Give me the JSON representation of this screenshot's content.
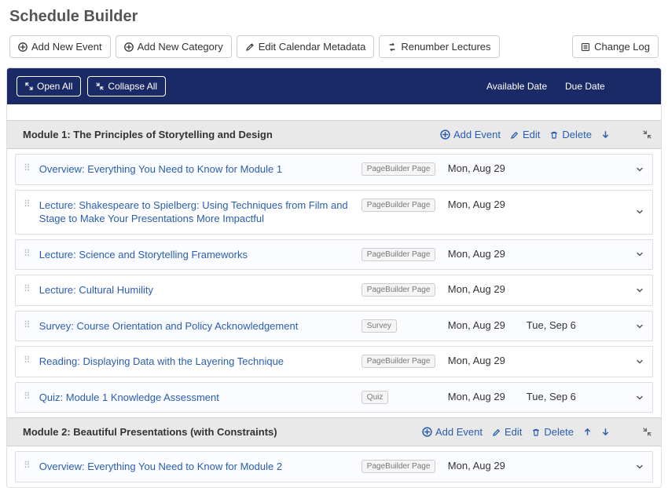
{
  "page": {
    "title": "Schedule Builder"
  },
  "toolbar": {
    "add_event": "Add New Event",
    "add_category": "Add New Category",
    "edit_metadata": "Edit Calendar Metadata",
    "renumber": "Renumber Lectures",
    "change_log": "Change Log"
  },
  "bluebar": {
    "open_all": "Open All",
    "collapse_all": "Collapse All",
    "available_header": "Available Date",
    "due_header": "Due Date"
  },
  "module_actions": {
    "add_event": "Add Event",
    "edit": "Edit",
    "delete": "Delete"
  },
  "modules": [
    {
      "title": "Module 1: The Principles of Storytelling and Design",
      "show_up": false,
      "show_down": true,
      "items": [
        {
          "title": "Overview: Everything You Need to Know for Module 1",
          "badge": "PageBuilder Page",
          "available": "Mon, Aug 29",
          "due": ""
        },
        {
          "title": "Lecture: Shakespeare to Spielberg: Using Techniques from Film and Stage to Make Your Presentations More Impactful",
          "badge": "PageBuilder Page",
          "available": "Mon, Aug 29",
          "due": ""
        },
        {
          "title": "Lecture: Science and Storytelling Frameworks",
          "badge": "PageBuilder Page",
          "available": "Mon, Aug 29",
          "due": ""
        },
        {
          "title": "Lecture: Cultural Humility",
          "badge": "PageBuilder Page",
          "available": "Mon, Aug 29",
          "due": ""
        },
        {
          "title": "Survey: Course Orientation and Policy Acknowledgement",
          "badge": "Survey",
          "available": "Mon, Aug 29",
          "due": "Tue, Sep 6"
        },
        {
          "title": "Reading: Displaying Data with the Layering Technique",
          "badge": "PageBuilder Page",
          "available": "Mon, Aug 29",
          "due": ""
        },
        {
          "title": "Quiz: Module 1 Knowledge Assessment",
          "badge": "Quiz",
          "available": "Mon, Aug 29",
          "due": "Tue, Sep 6"
        }
      ]
    },
    {
      "title": "Module 2: Beautiful Presentations (with Constraints)",
      "show_up": true,
      "show_down": true,
      "items": [
        {
          "title": "Overview: Everything You Need to Know for Module 2",
          "badge": "PageBuilder Page",
          "available": "Mon, Aug 29",
          "due": ""
        }
      ]
    }
  ]
}
